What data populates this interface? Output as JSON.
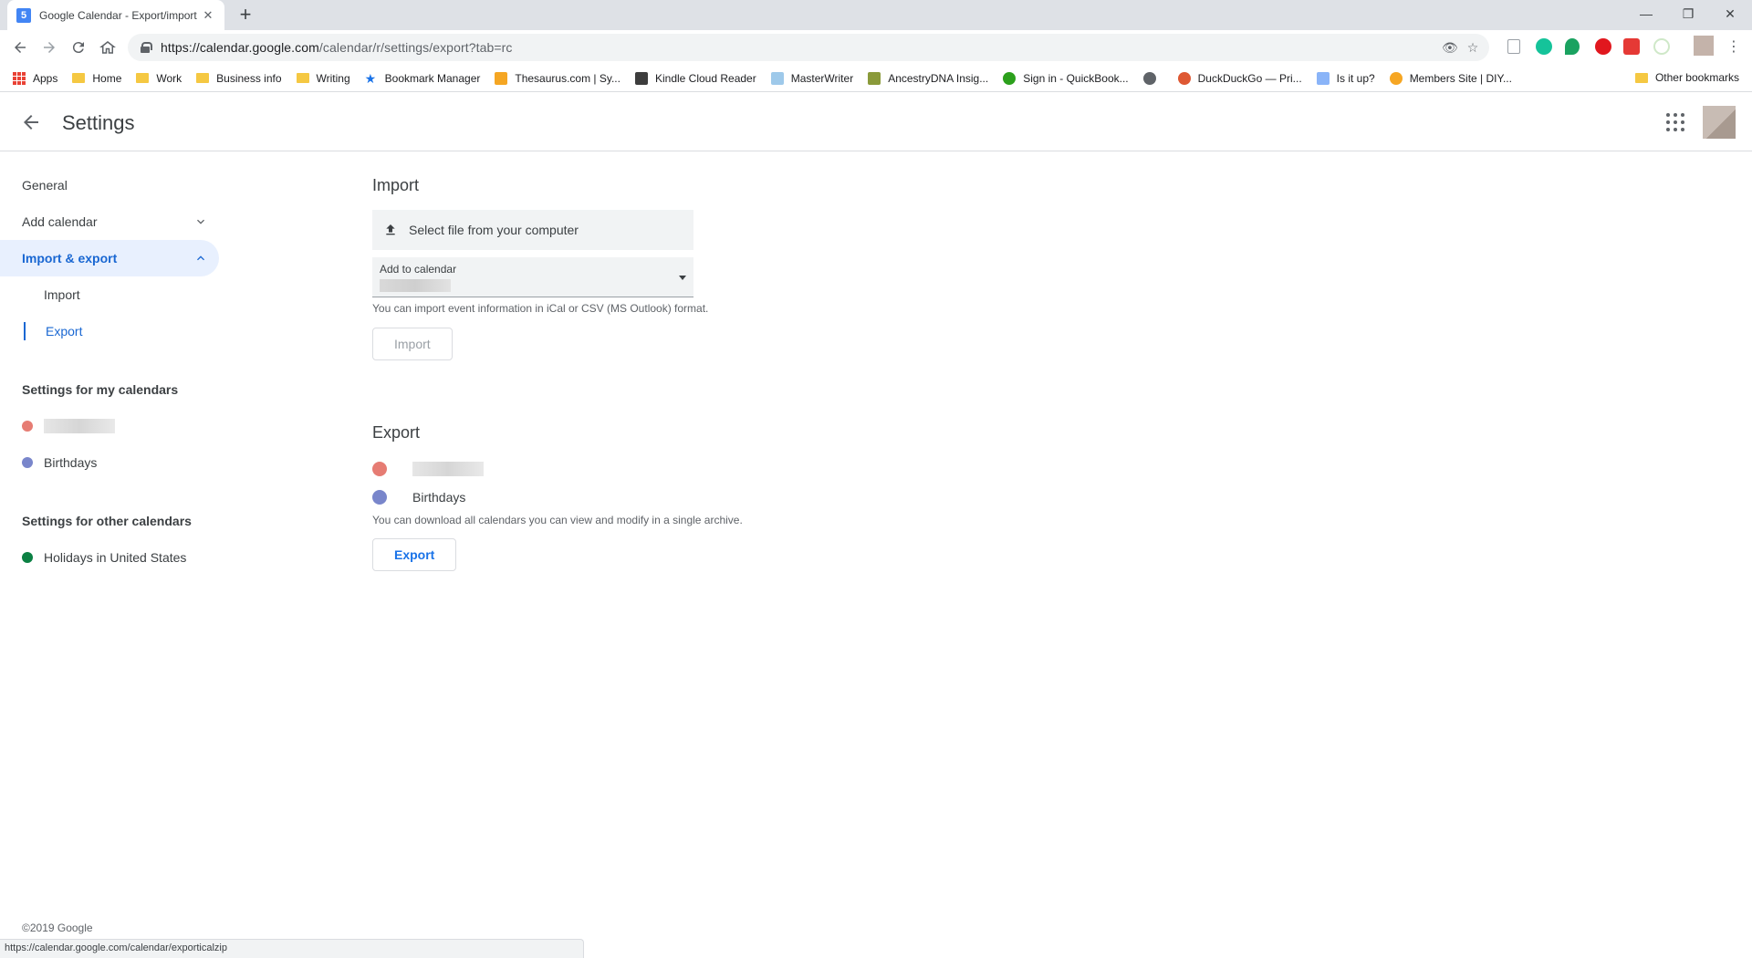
{
  "browser": {
    "tab_title": "Google Calendar - Export/import",
    "tab_favicon": "5",
    "url_host": "https://calendar.google.com",
    "url_path": "/calendar/r/settings/export?tab=rc",
    "bookmarks": [
      {
        "label": "Apps",
        "icon": "apps-icon"
      },
      {
        "label": "Home",
        "icon": "folder-icon"
      },
      {
        "label": "Work",
        "icon": "folder-icon"
      },
      {
        "label": "Business info",
        "icon": "folder-icon"
      },
      {
        "label": "Writing",
        "icon": "folder-icon"
      },
      {
        "label": "Bookmark Manager",
        "icon": "star-icon"
      },
      {
        "label": "Thesaurus.com | Sy...",
        "icon": "thesaurus-icon"
      },
      {
        "label": "Kindle Cloud Reader",
        "icon": "kindle-icon"
      },
      {
        "label": "MasterWriter",
        "icon": "masterwriter-icon"
      },
      {
        "label": "AncestryDNA Insig...",
        "icon": "ancestry-icon"
      },
      {
        "label": "Sign in - QuickBook...",
        "icon": "quickbooks-icon"
      },
      {
        "label": "",
        "icon": "globe-icon"
      },
      {
        "label": "DuckDuckGo — Pri...",
        "icon": "duckduckgo-icon"
      },
      {
        "label": "Is it up?",
        "icon": "wrench-icon"
      },
      {
        "label": "Members Site | DIY...",
        "icon": "members-icon"
      }
    ],
    "other_bookmarks": "Other bookmarks",
    "status_url": "https://calendar.google.com/calendar/exporticalzip"
  },
  "app": {
    "page_title": "Settings",
    "footer": "©2019 Google"
  },
  "sidebar": {
    "general": "General",
    "add_calendar": "Add calendar",
    "import_export": "Import & export",
    "import": "Import",
    "export": "Export",
    "my_calendars_heading": "Settings for my calendars",
    "my_calendars": [
      {
        "label": "",
        "color": "#e67c73"
      },
      {
        "label": "Birthdays",
        "color": "#7986cb"
      }
    ],
    "other_calendars_heading": "Settings for other calendars",
    "other_calendars": [
      {
        "label": "Holidays in United States",
        "color": "#0b8043"
      }
    ]
  },
  "import_section": {
    "title": "Import",
    "select_file": "Select file from your computer",
    "add_to_calendar_label": "Add to calendar",
    "help": "You can import event information in iCal or CSV (MS Outlook) format.",
    "button": "Import"
  },
  "export_section": {
    "title": "Export",
    "calendars": [
      {
        "label": "",
        "color": "#e67c73"
      },
      {
        "label": "Birthdays",
        "color": "#7986cb"
      }
    ],
    "help": "You can download all calendars you can view and modify in a single archive.",
    "button": "Export"
  }
}
